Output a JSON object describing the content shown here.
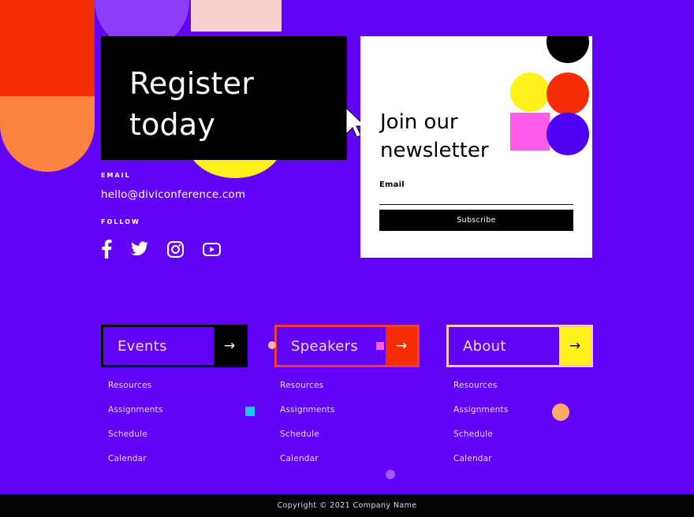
{
  "theme": {
    "background": "#6104f5",
    "black": "#000000",
    "white": "#ffffff",
    "red": "#f42d07",
    "orange": "#fb8240",
    "yellow": "#fff119",
    "pink": "#fd5be8",
    "light_pink": "#f8d0d0",
    "lilac": "#8b3cf7",
    "cyan": "#19c6f4",
    "peach": "#fba96b",
    "speakers_border": "#ef3b37",
    "about_border": "#f8c6b4"
  },
  "hero": {
    "register_card": {
      "title": "Register\ntoday",
      "cursor_icon": "mouse-pointer-icon"
    },
    "shapes": [
      {
        "name": "red-block-shape"
      },
      {
        "name": "orange-pill-shape"
      },
      {
        "name": "lilac-circle-shape"
      },
      {
        "name": "pink-rectangle-shape"
      },
      {
        "name": "yellow-circle-shape"
      }
    ]
  },
  "contact": {
    "email_kicker": "EMAIL",
    "email_value": "hello@diviconference.com",
    "follow_kicker": "FOLLOW",
    "social": [
      {
        "name": "facebook-icon",
        "label": "Facebook"
      },
      {
        "name": "twitter-icon",
        "label": "Twitter"
      },
      {
        "name": "instagram-icon",
        "label": "Instagram"
      },
      {
        "name": "youtube-icon",
        "label": "YouTube"
      }
    ]
  },
  "newsletter": {
    "title": "Join our\nnewsletter",
    "field_label": "Email",
    "field_value": "",
    "field_placeholder": "",
    "submit_label": "Subscribe",
    "shapes": [
      {
        "name": "black-circle-shape"
      },
      {
        "name": "yellow-circle-shape"
      },
      {
        "name": "red-circle-shape"
      },
      {
        "name": "pink-square-shape"
      },
      {
        "name": "purple-circle-shape"
      }
    ]
  },
  "menu": {
    "buttons": [
      {
        "label": "Events",
        "arrow": "→",
        "chip": null
      },
      {
        "label": "Speakers",
        "arrow": "→",
        "chip": "#fd5be8"
      },
      {
        "label": "About",
        "arrow": "→",
        "chip": null
      }
    ]
  },
  "link_columns": [
    {
      "items": [
        "Resources",
        "Assignments",
        "Schedule",
        "Calendar"
      ]
    },
    {
      "items": [
        "Resources",
        "Assignments",
        "Schedule",
        "Calendar"
      ]
    },
    {
      "items": [
        "Resources",
        "Assignments",
        "Schedule",
        "Calendar"
      ]
    }
  ],
  "footer": {
    "copyright": "Copyright © 2021 Company Name"
  }
}
